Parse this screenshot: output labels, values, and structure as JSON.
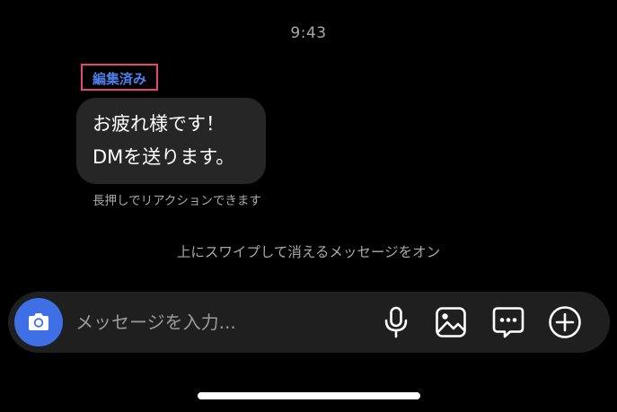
{
  "thread": {
    "timestamp": "9:43",
    "message": {
      "edited_label": "編集済み",
      "lines": [
        "お疲れ様です！",
        "DMを送ります。"
      ],
      "hint": "長押しでリアクションできます"
    },
    "vanish_mode_text": "上にスワイプして消えるメッセージをオン"
  },
  "composer": {
    "placeholder": "メッセージを入力...",
    "camera_icon": "camera-icon",
    "tools": [
      "microphone-icon",
      "image-icon",
      "sticker-icon",
      "plus-circle-icon"
    ]
  },
  "colors": {
    "background": "#000000",
    "bubble": "#262626",
    "composer": "#1f1f1f",
    "accent_blue": "#3f6fe4",
    "edited_text": "#4f7fe8",
    "highlight_border": "#e6457a",
    "muted_text": "#a8a8a8"
  }
}
